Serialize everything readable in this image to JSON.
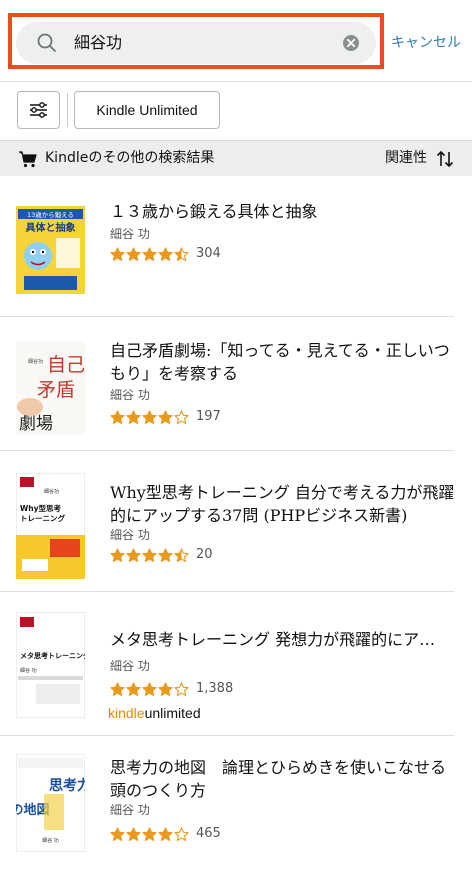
{
  "search": {
    "query": "細谷功",
    "cancel_label": "キャンセル"
  },
  "filters": {
    "kindle_unlimited_label": "Kindle Unlimited"
  },
  "section": {
    "title": "Kindleのその他の検索結果",
    "sort_label": "関連性"
  },
  "colors": {
    "highlight": "#f04a1f",
    "link": "#2b7fb8",
    "star": "#e99a1d",
    "ku_orange": "#e98a00"
  },
  "results": [
    {
      "title": "１３歳から鍛える具体と抽象",
      "author": "細谷 功",
      "rating": 4.5,
      "review_count": "304",
      "kindle_unlimited": false,
      "cover_text": [
        "13歳から鍛える",
        "具体と抽象"
      ]
    },
    {
      "title": "自己矛盾劇場:「知ってる・見えてる・正しいつもり」を考察する",
      "author": "細谷 功",
      "rating": 4.0,
      "review_count": "197",
      "kindle_unlimited": false,
      "cover_text": [
        "自己",
        "矛盾",
        "劇場",
        "細谷功"
      ]
    },
    {
      "title": "Why型思考トレーニング 自分で考える力が飛躍的にアップする37問 (PHPビジネス新書)",
      "author": "細谷 功",
      "rating": 4.5,
      "review_count": "20",
      "kindle_unlimited": false,
      "cover_text": [
        "Why型思考",
        "トレーニング",
        "細谷功"
      ]
    },
    {
      "title": "メタ思考トレーニング 発想力が飛躍的にア…",
      "author": "細谷 功",
      "rating": 4.0,
      "review_count": "1,388",
      "kindle_unlimited": true,
      "ku_kindle": "kindle",
      "ku_unlimited": "unlimited",
      "cover_text": [
        "メタ思考トレーニング",
        "細谷 功"
      ]
    },
    {
      "title": "思考力の地図　論理とひらめきを使いこなせる頭のつくり方",
      "author": "細谷 功",
      "rating": 4.0,
      "review_count": "465",
      "kindle_unlimited": false,
      "cover_text": [
        "思考力",
        "の地図",
        "細谷 功"
      ]
    }
  ]
}
